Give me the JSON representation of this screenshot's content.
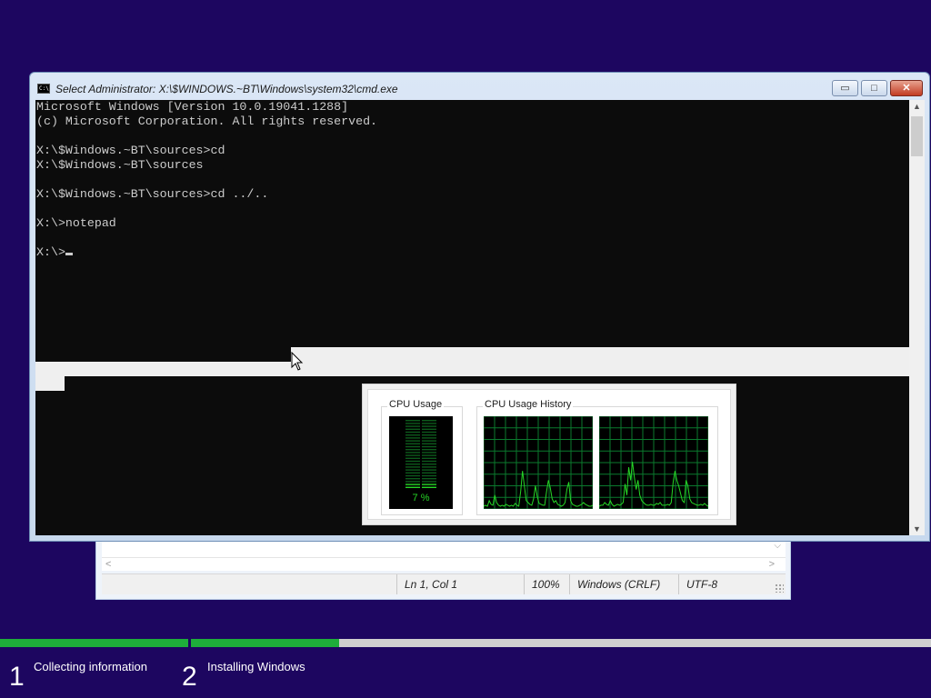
{
  "notepad": {
    "status": {
      "position": "Ln 1, Col 1",
      "zoom": "100%",
      "line_endings": "Windows (CRLF)",
      "encoding": "UTF-8"
    }
  },
  "cmd": {
    "title": "Select Administrator: X:\\$WINDOWS.~BT\\Windows\\system32\\cmd.exe",
    "icon": "C:\\",
    "buttons": {
      "minimize": "▭",
      "maximize": "□",
      "close": "✕"
    },
    "lines": [
      "Microsoft Windows [Version 10.0.19041.1288]",
      "(c) Microsoft Corporation. All rights reserved.",
      "",
      "X:\\$Windows.~BT\\sources>cd",
      "X:\\$Windows.~BT\\sources",
      "",
      "X:\\$Windows.~BT\\sources>cd ../..",
      "",
      "X:\\>notepad",
      ""
    ],
    "prompt": "X:\\>"
  },
  "taskmgr": {
    "cpu_usage_label": "CPU Usage",
    "cpu_history_label": "CPU Usage History",
    "cpu_percent_text": "7 %",
    "cpu_percent": 7,
    "graph_color": "#26d626",
    "grid_color": "#0b7a2e",
    "history1": [
      2,
      3,
      2,
      8,
      4,
      3,
      14,
      6,
      3,
      2,
      3,
      2,
      4,
      3,
      2,
      3,
      2,
      5,
      3,
      2,
      18,
      40,
      24,
      8,
      6,
      4,
      3,
      10,
      24,
      12,
      5,
      4,
      3,
      3,
      18,
      30,
      22,
      10,
      6,
      8,
      4,
      3,
      2,
      3,
      6,
      20,
      28,
      8,
      4,
      3,
      2,
      2,
      3,
      4,
      6,
      4,
      3,
      2,
      2,
      3
    ],
    "history2": [
      2,
      3,
      3,
      6,
      4,
      3,
      8,
      4,
      2,
      3,
      4,
      3,
      4,
      6,
      26,
      14,
      44,
      30,
      50,
      34,
      20,
      30,
      14,
      8,
      6,
      4,
      3,
      3,
      4,
      3,
      3,
      5,
      4,
      6,
      3,
      3,
      3,
      4,
      3,
      6,
      28,
      40,
      30,
      24,
      16,
      8,
      6,
      30,
      24,
      10,
      6,
      5,
      4,
      3,
      3,
      4,
      3,
      5,
      3,
      2
    ]
  },
  "setup": {
    "steps": [
      {
        "number": "1",
        "label": "Collecting information",
        "progress": 1.0
      },
      {
        "number": "2",
        "label": "Installing Windows",
        "progress": 0.2
      }
    ]
  }
}
